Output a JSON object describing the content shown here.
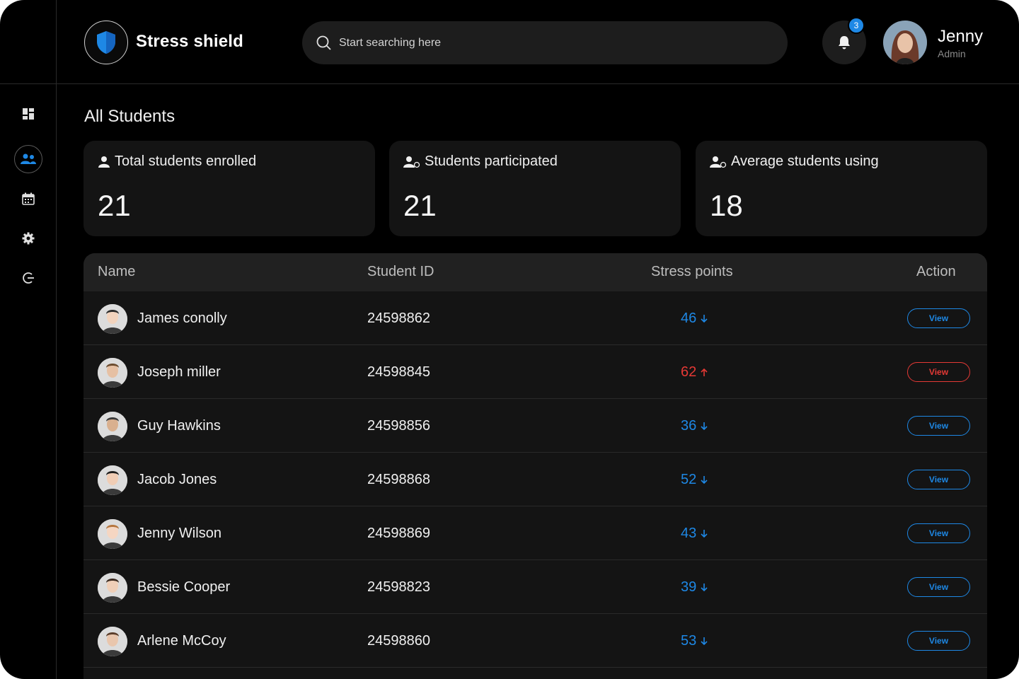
{
  "app": {
    "brand": "Stress shield"
  },
  "search": {
    "placeholder": "Start searching here"
  },
  "notifications": {
    "count": "3"
  },
  "user": {
    "name": "Jenny",
    "role": "Admin"
  },
  "sidebar": {
    "items": [
      {
        "icon": "dashboard-icon"
      },
      {
        "icon": "students-icon",
        "active": true
      },
      {
        "icon": "calendar-icon"
      },
      {
        "icon": "settings-icon"
      },
      {
        "icon": "logout-icon"
      }
    ]
  },
  "page": {
    "title": "All Students"
  },
  "stats": [
    {
      "label": "Total students enrolled",
      "value": "21",
      "icon": "user-icon"
    },
    {
      "label": "Students participated",
      "value": "21",
      "icon": "user-check-icon"
    },
    {
      "label": "Average students using",
      "value": "18",
      "icon": "user-check-icon"
    }
  ],
  "table": {
    "columns": [
      "Name",
      "Student ID",
      "Stress points",
      "Action"
    ],
    "rows": [
      {
        "name": "James conolly",
        "id": "24598862",
        "points": "46",
        "trend": "down",
        "action": "View"
      },
      {
        "name": "Joseph miller",
        "id": "24598845",
        "points": "62",
        "trend": "up",
        "action": "View"
      },
      {
        "name": "Guy Hawkins",
        "id": "24598856",
        "points": "36",
        "trend": "down",
        "action": "View"
      },
      {
        "name": "Jacob Jones",
        "id": "24598868",
        "points": "52",
        "trend": "down",
        "action": "View"
      },
      {
        "name": "Jenny Wilson",
        "id": "24598869",
        "points": "43",
        "trend": "down",
        "action": "View"
      },
      {
        "name": "Bessie Cooper",
        "id": "24598823",
        "points": "39",
        "trend": "down",
        "action": "View"
      },
      {
        "name": "Arlene McCoy",
        "id": "24598860",
        "points": "53",
        "trend": "down",
        "action": "View"
      }
    ]
  },
  "colors": {
    "accent": "#1e88e5",
    "danger": "#e53935",
    "background": "#000000",
    "card": "#141414"
  }
}
